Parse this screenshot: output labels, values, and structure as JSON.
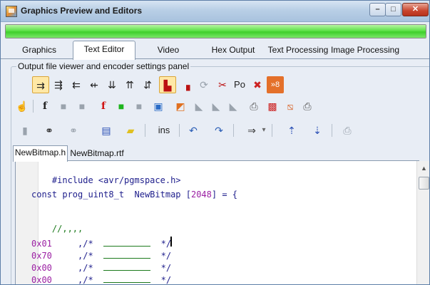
{
  "window": {
    "title": "Graphics Preview and Editors",
    "controls": {
      "minimize": "–",
      "maximize": "□",
      "close": "✕"
    }
  },
  "progress": {
    "value": 1.0,
    "color": "#3fcf2c"
  },
  "tabs": [
    {
      "label": "Graphics",
      "active": false
    },
    {
      "label": "Text Editor",
      "active": true
    },
    {
      "label": "Video",
      "active": false
    },
    {
      "label": "Hex Output",
      "active": false
    },
    {
      "label": "Text Processing",
      "active": false
    },
    {
      "label": "Image Processing",
      "active": false
    }
  ],
  "panel": {
    "label": "Output file viewer and encoder settings panel"
  },
  "toolbar1": {
    "items": [
      {
        "icon": "format-arrows-1-icon",
        "glyph": "⇉",
        "pressed": true
      },
      {
        "icon": "format-arrows-2-icon",
        "glyph": "⇶",
        "pressed": false
      },
      {
        "icon": "format-arrows-3-icon",
        "glyph": "⇇",
        "pressed": false
      },
      {
        "icon": "format-arrows-4-icon",
        "glyph": "⇷",
        "pressed": false
      },
      {
        "icon": "format-arrows-5-icon",
        "glyph": "⇊",
        "pressed": false
      },
      {
        "icon": "format-arrows-6-icon",
        "glyph": "⇈",
        "pressed": false
      },
      {
        "icon": "format-arrows-7-icon",
        "glyph": "⇵",
        "pressed": false
      },
      {
        "icon": "bar-chart-icon",
        "glyph": "▙",
        "pressed": true
      },
      {
        "icon": "bar-chart-small-icon",
        "glyph": "▗",
        "pressed": false
      },
      {
        "icon": "refresh-gray-icon",
        "glyph": "⟳",
        "pressed": false
      },
      {
        "icon": "strike-icon",
        "glyph": "✂",
        "pressed": false
      },
      {
        "icon": "po-text-icon",
        "glyph": "Po",
        "pressed": false
      },
      {
        "icon": "cross-out-icon",
        "glyph": "✖",
        "pressed": false
      },
      {
        "icon": "shift-8-icon",
        "glyph": "»8",
        "pressed": false
      }
    ]
  },
  "toolbar2": {
    "items": [
      {
        "icon": "hand-icon",
        "glyph": "☝"
      },
      {
        "icon": "f-icon",
        "glyph": "f"
      },
      {
        "icon": "gray-square-1-icon",
        "glyph": "■"
      },
      {
        "icon": "gray-square-2-icon",
        "glyph": "■"
      },
      {
        "icon": "red-f-icon",
        "glyph": "f"
      },
      {
        "icon": "green-square-icon",
        "glyph": "■"
      },
      {
        "icon": "gray-square-3-icon",
        "glyph": "■"
      },
      {
        "icon": "image-icon",
        "glyph": "▣"
      },
      {
        "icon": "fill-icon",
        "glyph": "◩"
      },
      {
        "icon": "speech-1-icon",
        "glyph": "◣"
      },
      {
        "icon": "speech-2-icon",
        "glyph": "◣"
      },
      {
        "icon": "speech-3-icon",
        "glyph": "◣"
      },
      {
        "icon": "print-icon",
        "glyph": "⎙"
      },
      {
        "icon": "red-frame-icon",
        "glyph": "▩"
      },
      {
        "icon": "diagonal-icon",
        "glyph": "⧅"
      },
      {
        "icon": "printer-icon",
        "glyph": "⎙"
      }
    ]
  },
  "toolbar3": {
    "items": [
      {
        "icon": "paste-icon",
        "glyph": "▮"
      },
      {
        "icon": "binoculars-icon",
        "glyph": "⚭"
      },
      {
        "icon": "binoculars-gray-icon",
        "glyph": "⚭"
      },
      {
        "icon": "save-icon",
        "glyph": "▤"
      },
      {
        "icon": "highlight-icon",
        "glyph": "▰"
      },
      {
        "icon": "ins-icon",
        "glyph": "ins"
      },
      {
        "icon": "undo-icon",
        "glyph": "↶"
      },
      {
        "icon": "redo-icon",
        "glyph": "↷"
      },
      {
        "icon": "indent-icon",
        "glyph": "⇒"
      },
      {
        "icon": "dropdown-arrow-icon",
        "glyph": "▾"
      },
      {
        "icon": "sort-up-icon",
        "glyph": "⇡"
      },
      {
        "icon": "sort-down-icon",
        "glyph": "⇣"
      },
      {
        "icon": "print-gray-icon",
        "glyph": "⎙"
      }
    ]
  },
  "files": [
    {
      "label": "NewBitmap.h",
      "active": true
    },
    {
      "label": "NewBitmap.rtf",
      "active": false
    }
  ],
  "code": {
    "include": "#include <avr/pgmspace.h>",
    "decl_prefix": "const prog_uint8_t  NewBitmap [",
    "decl_num": "2048",
    "decl_suffix": "] = {",
    "comment": "//,,,,",
    "rows": [
      {
        "hex": "0x01",
        "sep": "     ,/*",
        "end": "*/"
      },
      {
        "hex": "0x70",
        "sep": "     ,/*",
        "end": "*/"
      },
      {
        "hex": "0x00",
        "sep": "     ,/*",
        "end": "*/"
      },
      {
        "hex": "0x00",
        "sep": "     ,/*",
        "end": "*/"
      }
    ]
  },
  "colors": {
    "code_text": "#1e1e8c",
    "number": "#9b1fa3",
    "comment": "#1c7a1c"
  }
}
